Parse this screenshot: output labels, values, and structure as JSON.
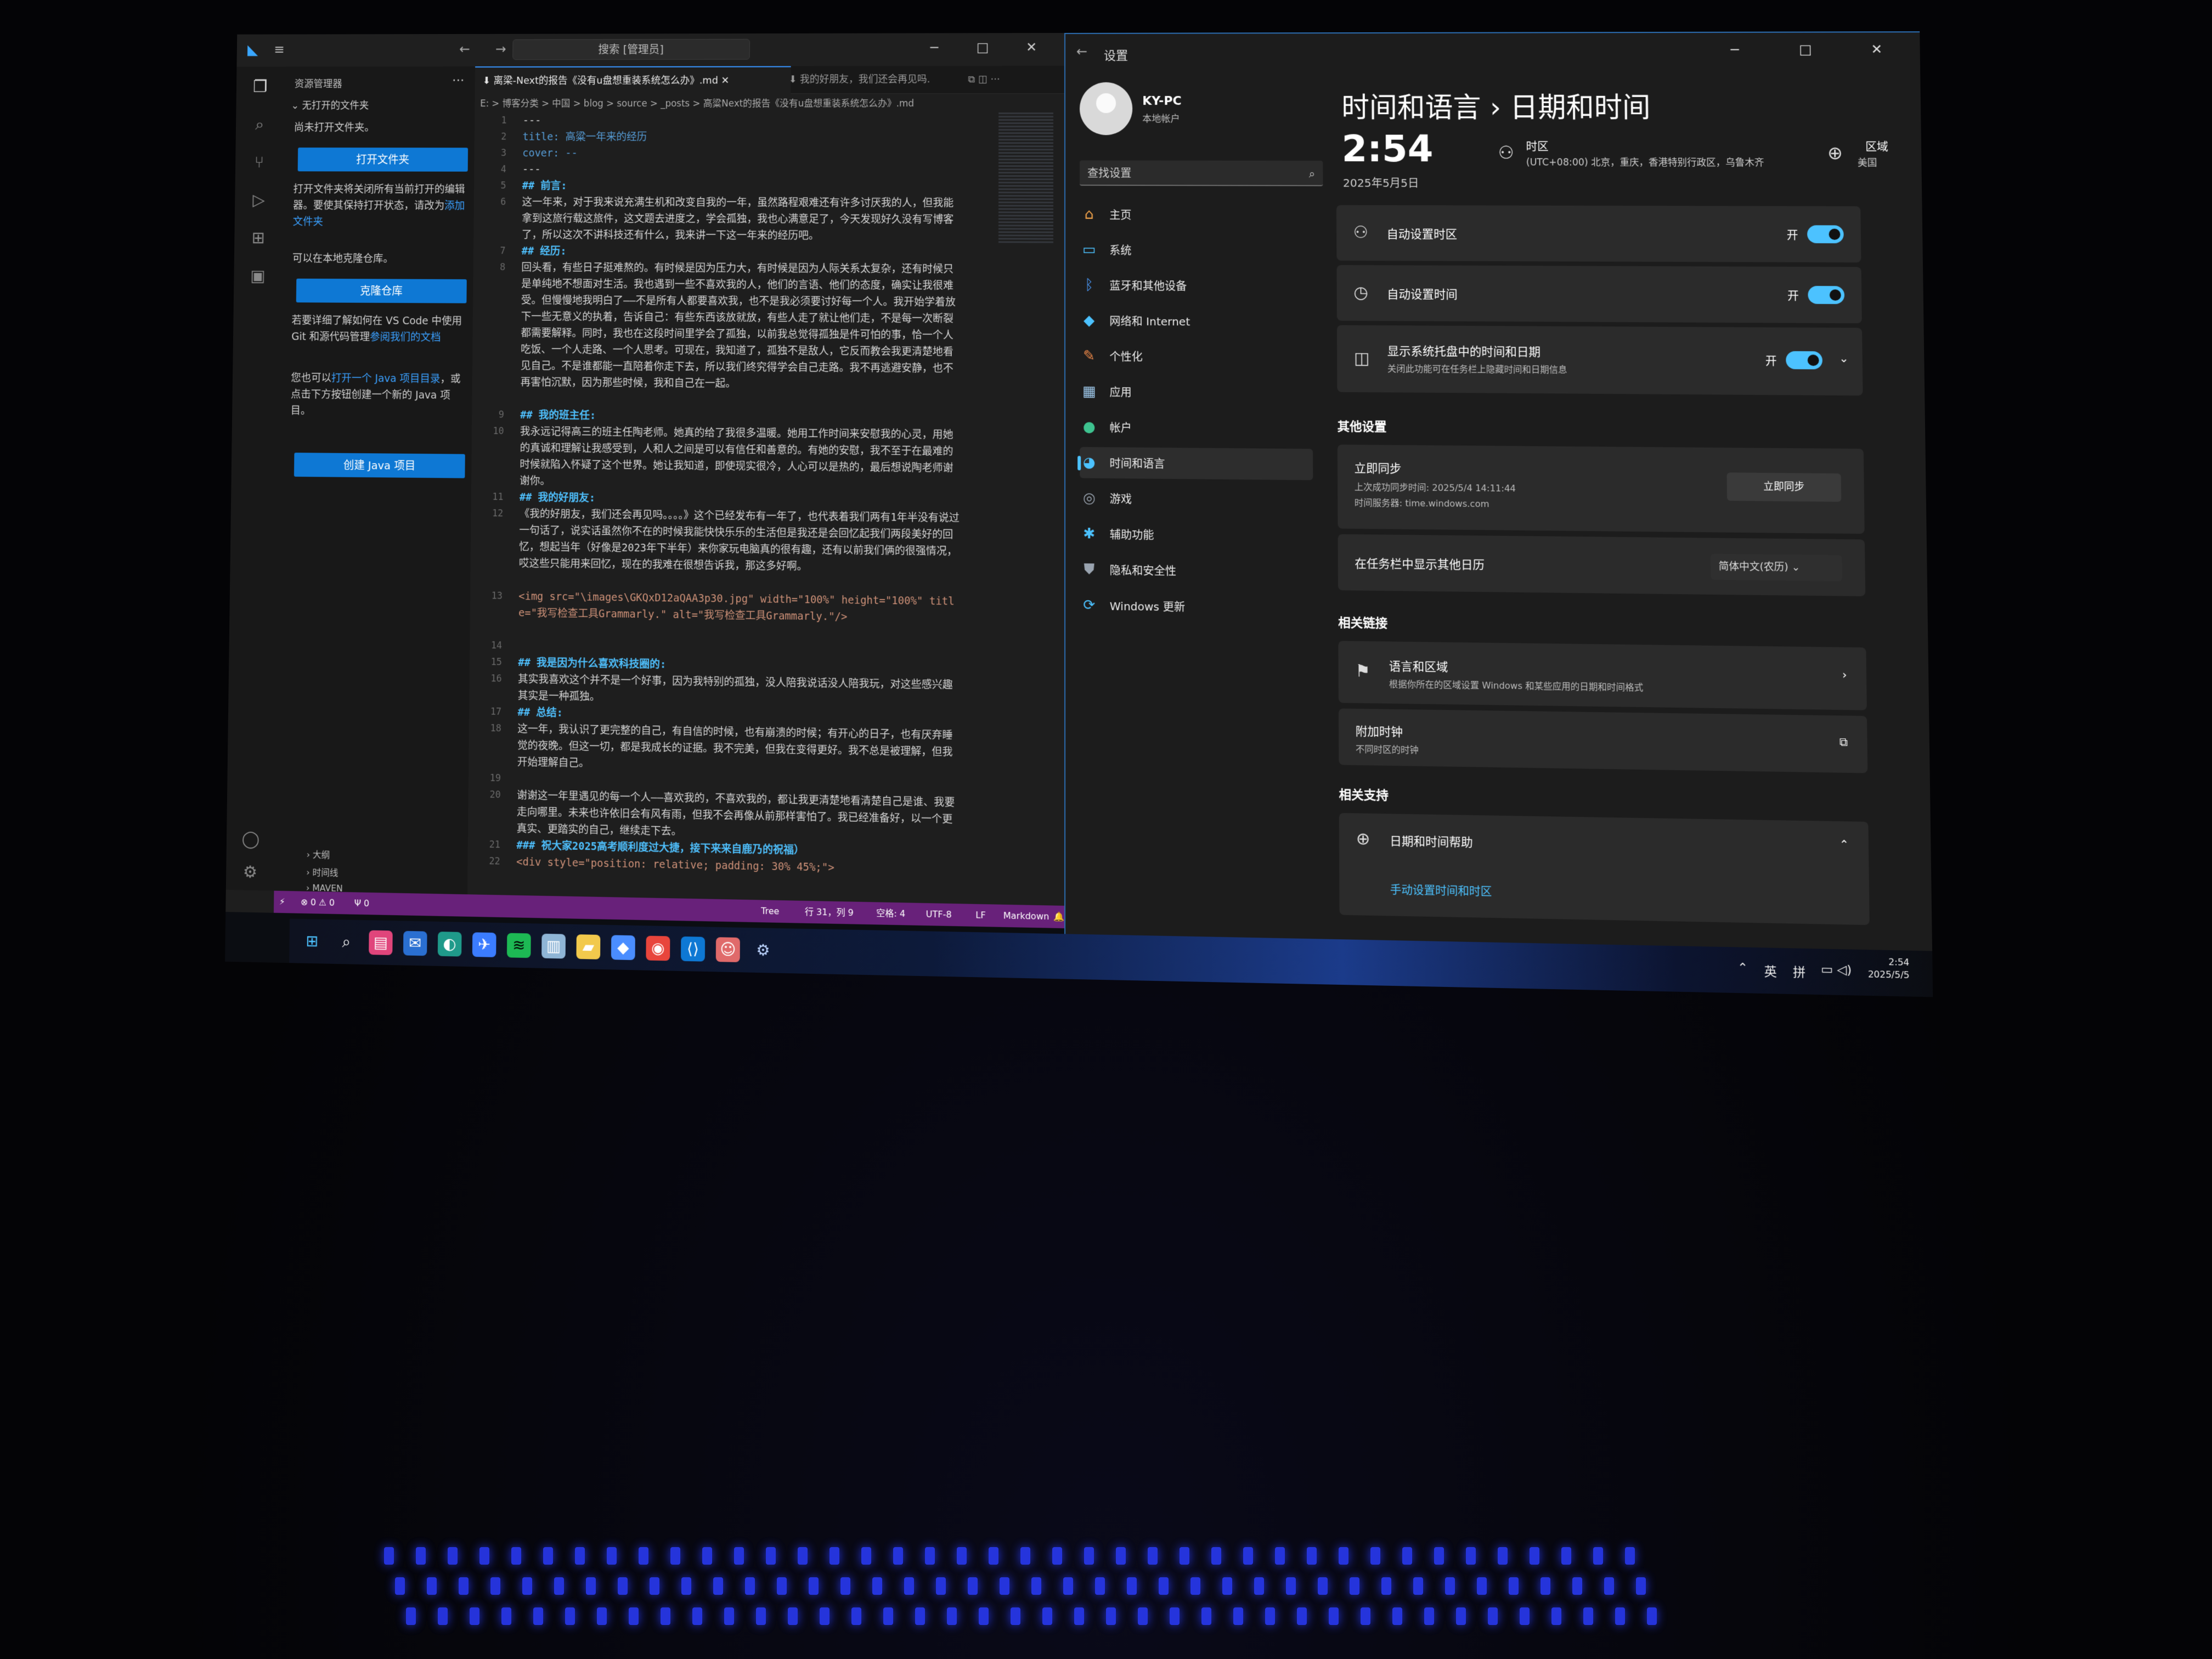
{
  "vscode": {
    "search": "搜索 [管理员]",
    "explorer_title": "资源管理器",
    "folder_header": "无打开的文件夹",
    "no_folder_text": "尚未打开文件夹。",
    "open_folder_btn": "打开文件夹",
    "open_folder_desc": "打开文件夹将关闭所有当前打开的编辑器。要使其保持打开状态，请改为",
    "open_folder_link": "添加文件夹",
    "clone_desc": "可以在本地克隆仓库。",
    "clone_btn": "克隆仓库",
    "git_desc": "若要详细了解如何在 VS Code 中使用 Git 和源代码管理",
    "git_link": "参阅我们的文档",
    "java_desc": "您也可以",
    "java_link": "打开一个 Java 项目目录",
    "java_desc2": "，或点击下方按钮创建一个新的 Java 项目。",
    "java_btn": "创建 Java 项目",
    "outline": "大纲",
    "timeline": "时间线",
    "maven": "MAVEN",
    "tab_active": "离梁-Next的报告《没有u盘想重装系统怎么办》.md",
    "tab_inactive": "我的好朋友，我们还会再见吗.",
    "breadcrumb": "E: > 博客分类 > 中国 > blog > source > _posts > 高粱Next的报告《没有u盘想重装系统怎么办》.md",
    "code_lines": [
      {
        "n": "1",
        "text": "---"
      },
      {
        "n": "2",
        "text": "title: 高粱一年来的经历"
      },
      {
        "n": "3",
        "text": "cover: --"
      },
      {
        "n": "4",
        "text": "---"
      },
      {
        "n": "5",
        "text": "## 前言:"
      },
      {
        "n": "6",
        "text": "这一年来，对于我来说充满生机和改变自我的一年，虽然路程艰难还有许多讨厌我的人，但我能拿到这旅行载这旅件，这文题去进度之，学会孤独，我也心满意足了，今天发现好久没有写博客了，所以这次不讲科技还有什么，我来讲一下这一年来的经历吧。"
      },
      {
        "n": "7",
        "text": "## 经历:"
      },
      {
        "n": "8",
        "text": "回头看，有些日子挺难熬的。有时候是因为压力大，有时候是因为人际关系太复杂，还有时候只是单纯地不想面对生活。我也遇到一些不喜欢我的人，他们的言语、他们的态度，确实让我很难受。但慢慢地我明白了——不是所有人都要喜欢我，也不是我必须要讨好每一个人。我开始学着放下一些无意义的执着，告诉自己：有些东西该放就放，有些人走了就让他们走，不是每一次断裂都需要解释。同时，我也在这段时间里学会了孤独，以前我总觉得孤独是件可怕的事，恰一个人吃饭、一个人走路、一个人思考。可现在，我知道了，孤独不是敌人，它反而教会我更清楚地看见自己。不是谁都能一直陪着你走下去，所以我们终究得学会自己走路。我不再逃避安静，也不再害怕沉默，因为那些时候，我和自己在一起。"
      },
      {
        "n": "9",
        "text": "## 我的班主任:"
      },
      {
        "n": "10",
        "text": "我永远记得高三的班主任陶老师。她真的给了我很多温暖。她用工作时间来安慰我的心灵，用她的真诚和理解让我感受到，人和人之间是可以有信任和善意的。有她的安慰，我不至于在最难的时候就陷入怀疑了这个世界。她让我知道，即使现实很冷，人心可以是热的，最后想说陶老师谢谢你。"
      },
      {
        "n": "11",
        "text": "## 我的好朋友:"
      },
      {
        "n": "12",
        "text": "《我的好朋友，我们还会再见吗。。。。》这个已经发布有一年了，也代表着我们两有1年半没有说过一句话了，说实话虽然你不在的时候我能快快乐乐的生活但是我还是会回忆起我们两段美好的回忆，想起当年（好像是2023年下半年）来你家玩电脑真的很有趣，还有以前我们俩的很强情况，哎这些只能用来回忆，现在的我难在很想告诉我，那这多好啊。"
      },
      {
        "n": "13",
        "text": "<img src=\"\\images\\GKQxD12aQAA3p30.jpg\" width=\"100%\" height=\"100%\" title=\"我写检查工具Grammarly.\" alt=\"我写检查工具Grammarly.\"/>"
      },
      {
        "n": "14",
        "text": ""
      },
      {
        "n": "15",
        "text": "## 我是因为什么喜欢科技圈的:"
      },
      {
        "n": "16",
        "text": "其实我喜欢这个并不是一个好事，因为我特别的孤独，没人陪我说话没人陪我玩，对这些感兴趣其实是一种孤独。"
      },
      {
        "n": "17",
        "text": "## 总结:"
      },
      {
        "n": "18",
        "text": "这一年，我认识了更完整的自己，有自信的时候，也有崩溃的时候；有开心的日子，也有厌弃睡觉的夜晚。但这一切，都是我成长的证据。我不完美，但我在变得更好。我不总是被理解，但我开始理解自己。"
      },
      {
        "n": "19",
        "text": ""
      },
      {
        "n": "20",
        "text": "谢谢这一年里遇见的每一个人——喜欢我的，不喜欢我的，都让我更清楚地看清楚自己是谁、我要走向哪里。未来也许依旧会有风有雨，但我不会再像从前那样害怕了。我已经准备好，以一个更真实、更踏实的自己，继续走下去。"
      },
      {
        "n": "21",
        "text": "### 祝大家2025高考顺利度过大捷，接下来来自鹿乃的祝福）"
      },
      {
        "n": "22",
        "text": "<div style=\"position: relative; padding: 30% 45%;\">"
      }
    ],
    "status": {
      "problems": "⊗ 0 ⚠ 0",
      "ports": "Ψ 0",
      "tree": "Tree",
      "position": "行 31，列 9",
      "spaces": "空格: 4",
      "encoding": "UTF-8",
      "eol": "LF",
      "language": "Markdown"
    }
  },
  "settings": {
    "window_title": "设置",
    "account_name": "KY-PC",
    "account_type": "本地帐户",
    "search_placeholder": "查找设置",
    "nav": [
      {
        "label": "主页",
        "icon": "⌂",
        "color": "#f0a24a"
      },
      {
        "label": "系统",
        "icon": "▭",
        "color": "#4cc2ff"
      },
      {
        "label": "蓝牙和其他设备",
        "icon": "ᛒ",
        "color": "#4c9dff"
      },
      {
        "label": "网络和 Internet",
        "icon": "◆",
        "color": "#4cc2ff"
      },
      {
        "label": "个性化",
        "icon": "✎",
        "color": "#f08a4a"
      },
      {
        "label": "应用",
        "icon": "▦",
        "color": "#9cc6e8"
      },
      {
        "label": "帐户",
        "icon": "●",
        "color": "#3ec28f"
      },
      {
        "label": "时间和语言",
        "icon": "◕",
        "color": "#4cc2ff"
      },
      {
        "label": "游戏",
        "icon": "◎",
        "color": "#9aa4b0"
      },
      {
        "label": "辅助功能",
        "icon": "✱",
        "color": "#4cc2ff"
      },
      {
        "label": "隐私和安全性",
        "icon": "⛊",
        "color": "#9aa4b0"
      },
      {
        "label": "Windows 更新",
        "icon": "⟳",
        "color": "#4cc2ff"
      }
    ],
    "breadcrumb_parent": "时间和语言",
    "breadcrumb_sep": "›",
    "breadcrumb_current": "日期和时间",
    "time": "2:54",
    "date": "2025年5月5日",
    "tz_label": "时区",
    "tz_value": "(UTC+08:00) 北京，重庆，香港特别行政区，乌鲁木齐",
    "region_label": "区域",
    "region_value": "美国",
    "auto_tz": "自动设置时区",
    "auto_time": "自动设置时间",
    "show_time_tray": "显示系统托盘中的时间和日期",
    "show_time_tray_sub": "关闭此功能可在任务栏上隐藏时间和日期信息",
    "toggle_on": "开",
    "other_settings": "其他设置",
    "sync_title": "立即同步",
    "sync_last": "上次成功同步时间: 2025/5/4 14:11:44",
    "sync_server": "时间服务器: time.windows.com",
    "sync_btn": "立即同步",
    "extra_calendar": "在任务栏中显示其他日历",
    "extra_calendar_value": "简体中文(农历)",
    "related_links": "相关链接",
    "lang_region": "语言和区域",
    "lang_region_sub": "根据你所在的区域设置 Windows 和某些应用的日期和时间格式",
    "extra_clocks": "附加时钟",
    "extra_clocks_sub": "不同时区的时钟",
    "related_support": "相关支持",
    "help_title": "日期和时间帮助",
    "help_link": "手动设置时间和时区"
  },
  "taskbar": {
    "icons": [
      {
        "name": "start-icon",
        "glyph": "⊞",
        "bg": "transparent",
        "color": "#4cc2ff"
      },
      {
        "name": "search-icon",
        "glyph": "⌕",
        "bg": "transparent",
        "color": "#ffffff"
      },
      {
        "name": "app-pink-icon",
        "glyph": "▤",
        "bg": "#e0457b",
        "color": "#ffffff"
      },
      {
        "name": "mail-icon",
        "glyph": "✉",
        "bg": "#2a6fd1",
        "color": "#ffffff"
      },
      {
        "name": "edge-icon",
        "glyph": "◐",
        "bg": "#1f9a8a",
        "color": "#ffffff"
      },
      {
        "name": "feishu-icon",
        "glyph": "✈",
        "bg": "#3b7cff",
        "color": "#ffffff"
      },
      {
        "name": "spotify-icon",
        "glyph": "≋",
        "bg": "#1db954",
        "color": "#000000"
      },
      {
        "name": "notepad-icon",
        "glyph": "▥",
        "bg": "#8fb5d6",
        "color": "#ffffff"
      },
      {
        "name": "folder-icon",
        "glyph": "▰",
        "bg": "#f2c94c",
        "color": "#ffffff"
      },
      {
        "name": "git-icon",
        "glyph": "◆",
        "bg": "#4a8dff",
        "color": "#ffffff"
      },
      {
        "name": "chrome-icon",
        "glyph": "◉",
        "bg": "#e8453c",
        "color": "#ffffff"
      },
      {
        "name": "vscode-icon",
        "glyph": "⟨⟩",
        "bg": "#0e78d4",
        "color": "#ffffff"
      },
      {
        "name": "profile-app-icon",
        "glyph": "☺",
        "bg": "#e06a6a",
        "color": "#ffffff"
      },
      {
        "name": "settings-icon",
        "glyph": "⚙",
        "bg": "transparent",
        "color": "#bcd4ff"
      }
    ],
    "tray_lang": "英",
    "tray_ime": "拼",
    "clock_time": "2:54",
    "clock_date": "2025/5/5"
  }
}
